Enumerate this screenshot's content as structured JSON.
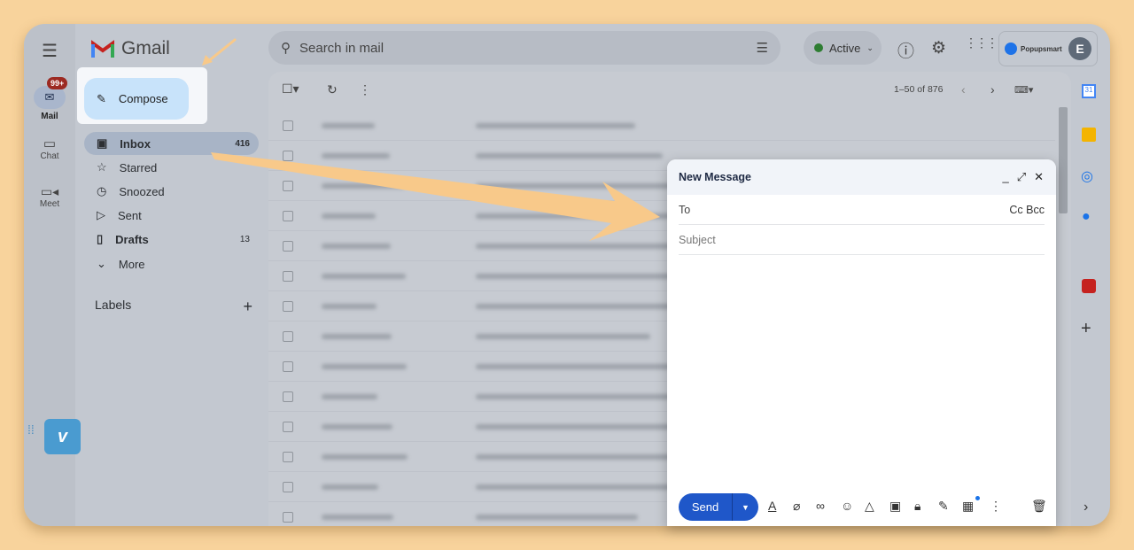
{
  "header": {
    "app_name": "Gmail",
    "search_placeholder": "Search in mail",
    "status": "Active",
    "account_brand": "Popupsmart",
    "avatar_initial": "E"
  },
  "rail": [
    {
      "label": "Mail",
      "badge": "99+"
    },
    {
      "label": "Chat"
    },
    {
      "label": "Meet"
    }
  ],
  "compose_label": "Compose",
  "nav": [
    {
      "label": "Inbox",
      "count": "416"
    },
    {
      "label": "Starred"
    },
    {
      "label": "Snoozed"
    },
    {
      "label": "Sent"
    },
    {
      "label": "Drafts",
      "count": "13"
    },
    {
      "label": "More"
    }
  ],
  "labels_title": "Labels",
  "toolbar": {
    "pagination": "1–50 of 876"
  },
  "dialog": {
    "title": "New Message",
    "to_label": "To",
    "cc_bcc": "Cc Bcc",
    "subject_placeholder": "Subject",
    "send_label": "Send"
  },
  "colors": {
    "accent": "#1f57c9",
    "highlight_arrow": "#f8c98a",
    "background": "#f8d39c"
  }
}
